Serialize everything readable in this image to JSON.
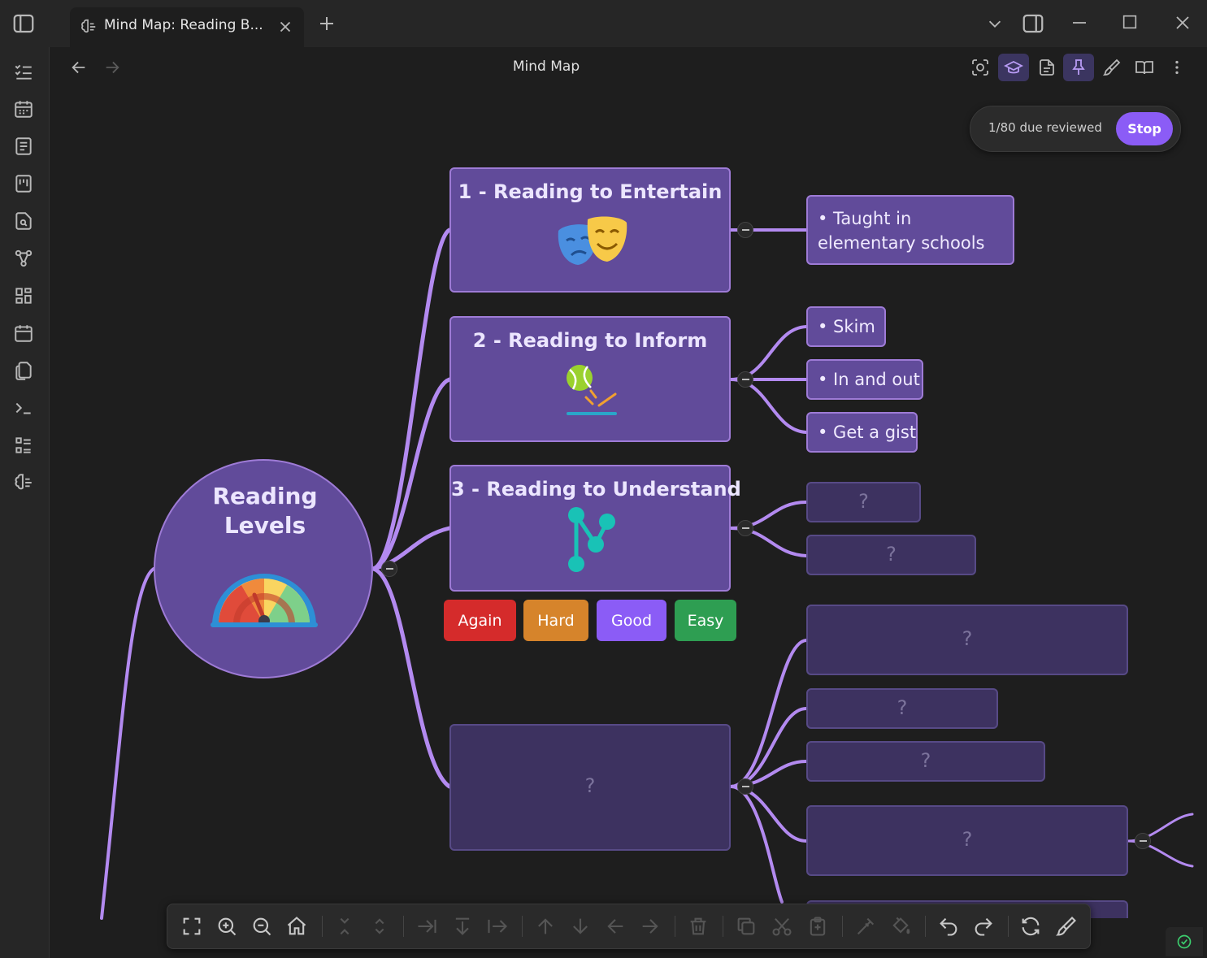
{
  "window": {
    "tab_title": "Mind Map: Reading B...",
    "view_title": "Mind Map"
  },
  "review": {
    "status": "1/80 due reviewed",
    "stop_label": "Stop"
  },
  "mindmap": {
    "root": {
      "title": "Reading Levels",
      "icon": "speedometer-icon"
    },
    "branches": [
      {
        "title": "1 - Reading to Entertain",
        "icon": "theater-masks-icon",
        "children": [
          "• Taught in elementary schools"
        ]
      },
      {
        "title": "2 - Reading to Inform",
        "icon": "tennis-ball-bounce-icon",
        "children": [
          "• Skim",
          "• In and out",
          "• Get a gist"
        ]
      },
      {
        "title": "3 - Reading to Understand",
        "icon": "network-nodes-icon",
        "children": [
          "?",
          "?"
        ]
      },
      {
        "title": "?",
        "children": [
          "?",
          "?",
          "?",
          "?"
        ]
      }
    ]
  },
  "grading": {
    "again": "Again",
    "hard": "Hard",
    "good": "Good",
    "easy": "Easy"
  },
  "colors": {
    "accent": "#8b5cf6",
    "node_fill": "#614b9a",
    "node_border": "#9e7bd6",
    "edge": "#b38af0",
    "again": "#d52b2b",
    "hard": "#d6842b",
    "good": "#8b5cf6",
    "easy": "#2e9e52"
  }
}
